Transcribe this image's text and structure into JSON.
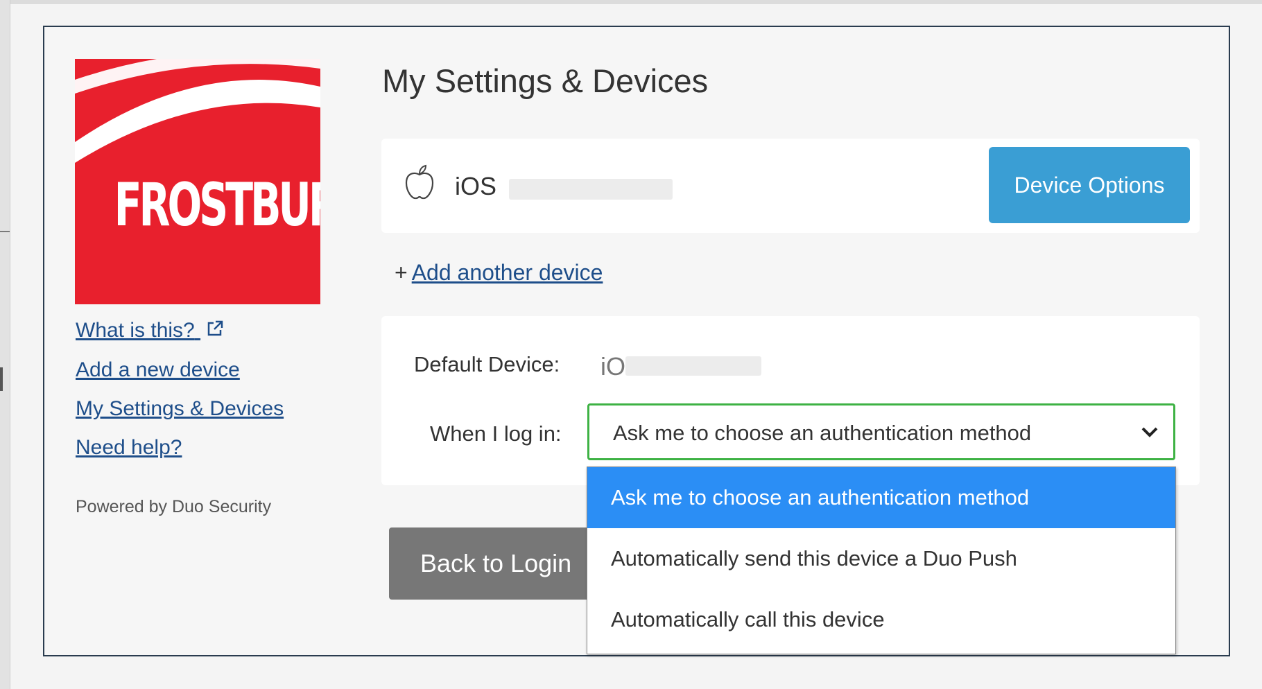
{
  "logo": {
    "text": "FROSTBURG",
    "color": "#e8202d"
  },
  "sidebar": {
    "links": [
      {
        "label": "What is this?"
      },
      {
        "label": "Add a new device"
      },
      {
        "label": "My Settings & Devices"
      },
      {
        "label": "Need help?"
      }
    ],
    "powered_by": "Powered by Duo Security"
  },
  "main": {
    "title": "My Settings & Devices",
    "device": {
      "icon": "apple-icon",
      "name": "iOS",
      "options_label": "Device Options"
    },
    "add_device": {
      "prefix": "+",
      "label": "Add another device"
    },
    "default_device": {
      "label": "Default Device:",
      "value": "iOS :"
    },
    "when_login": {
      "label": "When I log in:",
      "selected": "Ask me to choose an authentication method",
      "options": [
        "Ask me to choose an authentication method",
        "Automatically send this device a Duo Push",
        "Automatically call this device"
      ]
    },
    "back_button": "Back to Login"
  },
  "colors": {
    "accent_blue": "#3a9ed4",
    "link": "#1e4e8a",
    "focus_green": "#3eb244",
    "dropdown_highlight": "#2b8ef5"
  }
}
